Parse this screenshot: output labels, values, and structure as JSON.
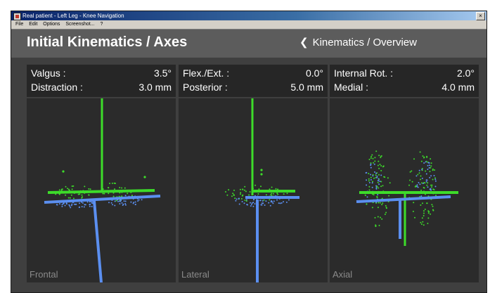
{
  "window": {
    "title": "Real patient - Left Leg - Knee Navigation",
    "menu": [
      "File",
      "Edit",
      "Options",
      "Screenshot...",
      "?"
    ]
  },
  "header": {
    "title": "Initial Kinematics / Axes",
    "nav_link": "Kinematics / Overview"
  },
  "colors": {
    "header_bg": "#5c5c5c",
    "panel_bg": "#2b2b2b",
    "readout_bg": "#262626",
    "axis_green": "#3ddc2a",
    "axis_blue": "#5b8ff0",
    "text": "#ffffff",
    "view_label": "#8a8a8a"
  },
  "panels": [
    {
      "view": "Frontal",
      "rows": [
        {
          "label": "Valgus :",
          "value": "3.5°"
        },
        {
          "label": "Distraction :",
          "value": "3.0 mm"
        }
      ]
    },
    {
      "view": "Lateral",
      "rows": [
        {
          "label": "Flex./Ext. :",
          "value": "0.0°"
        },
        {
          "label": "Posterior :",
          "value": "5.0 mm"
        }
      ]
    },
    {
      "view": "Axial",
      "rows": [
        {
          "label": "Internal Rot. :",
          "value": "2.0°"
        },
        {
          "label": "Medial :",
          "value": "4.0 mm"
        }
      ]
    }
  ],
  "icons": {
    "app": "app-icon",
    "back": "chevron-left-icon",
    "close": "close-icon"
  }
}
